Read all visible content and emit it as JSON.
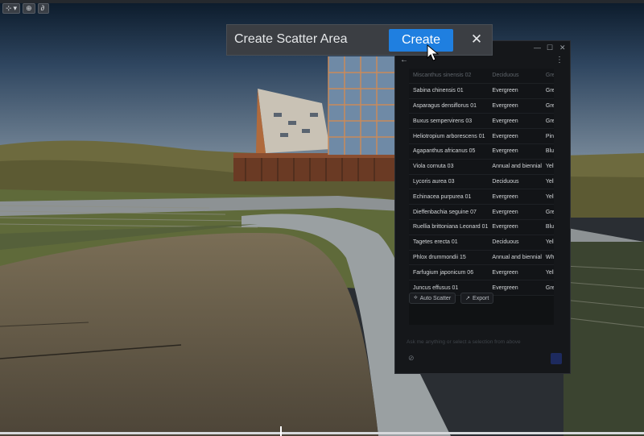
{
  "viewport": {
    "toolbar": [
      {
        "icon": "hierarchy-icon",
        "glyph": "⊹",
        "caret": "▾"
      },
      {
        "icon": "globe-icon",
        "glyph": "⊕",
        "caret": ""
      },
      {
        "icon": "link-icon",
        "glyph": "∂",
        "caret": ""
      }
    ]
  },
  "scatter_prompt": {
    "title": "Create Scatter Area",
    "create_label": "Create",
    "close_glyph": "✕"
  },
  "panel": {
    "win": {
      "minimize": "—",
      "maximize": "☐",
      "close": "✕"
    },
    "back_glyph": "←",
    "menu_glyph": "⋮",
    "plants": [
      {
        "name": "Miscanthus sinensis 02",
        "type": "Deciduous",
        "color": "Gree",
        "faded": true
      },
      {
        "name": "Sabina chinensis 01",
        "type": "Evergreen",
        "color": "Gree",
        "faded": false
      },
      {
        "name": "Asparagus densiflorus 01",
        "type": "Evergreen",
        "color": "Gree",
        "faded": false
      },
      {
        "name": "Buxus sempervirens 03",
        "type": "Evergreen",
        "color": "Gree",
        "faded": false
      },
      {
        "name": "Heliotropium arborescens 01",
        "type": "Evergreen",
        "color": "Pink",
        "faded": false
      },
      {
        "name": "Agapanthus africanus 05",
        "type": "Evergreen",
        "color": "Bluel",
        "faded": false
      },
      {
        "name": "Viola cornuta 03",
        "type": "Annual and biennial",
        "color": "Yello",
        "faded": false
      },
      {
        "name": "Lycoris aurea 03",
        "type": "Deciduous",
        "color": "Yello",
        "faded": false
      },
      {
        "name": "Echinacea purpurea 01",
        "type": "Evergreen",
        "color": "Yello",
        "faded": false
      },
      {
        "name": "Dieffenbachia seguine 07",
        "type": "Evergreen",
        "color": "Gree",
        "faded": false
      },
      {
        "name": "Ruellia brittoniana Leonard 01",
        "type": "Evergreen",
        "color": "Bluel",
        "faded": false
      },
      {
        "name": "Tagetes erecta 01",
        "type": "Deciduous",
        "color": "Yello",
        "faded": false
      },
      {
        "name": "Phlox drummondii 15",
        "type": "Annual and biennial",
        "color": "White",
        "faded": false
      },
      {
        "name": "Farfugium japonicum 06",
        "type": "Evergreen",
        "color": "Yello",
        "faded": false
      },
      {
        "name": "Juncus effusus 01",
        "type": "Evergreen",
        "color": "Gree",
        "faded": false
      }
    ],
    "auto_scatter_label": "Auto Scatter",
    "export_label": "Export",
    "chat_placeholder": "Ask me anything or select a selection from above"
  },
  "colors": {
    "accent": "#1f7fe0",
    "panel_bg": "#15171a"
  }
}
